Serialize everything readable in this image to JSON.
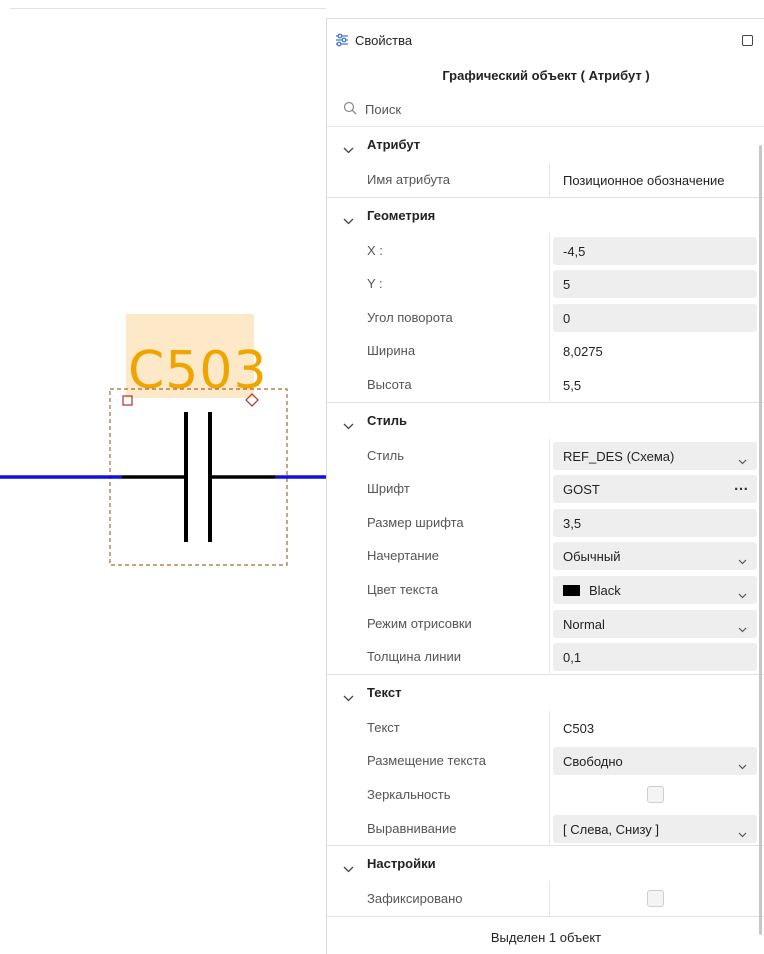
{
  "canvas": {
    "ref_designator": "C503",
    "colors": {
      "wire": "#1010e0",
      "symbol": "#000000",
      "label": "#f0a400",
      "label_bg": "#fde9c8",
      "selection": "#a06a3a"
    }
  },
  "panel": {
    "title": "Свойства",
    "object_title": "Графический объект ( Атрибут )",
    "search_placeholder": "Поиск",
    "status": "Выделен 1 объект",
    "icons": {
      "panel": "settings-sliders-icon",
      "maximize": "maximize-icon",
      "search": "search-icon"
    }
  },
  "sections": [
    {
      "title": "Атрибут",
      "rows": [
        {
          "label": "Имя атрибута",
          "value": "Позиционное обозначение",
          "control": "text"
        }
      ]
    },
    {
      "title": "Геометрия",
      "rows": [
        {
          "label": "X :",
          "value": "-4,5",
          "control": "input"
        },
        {
          "label": "Y :",
          "value": "5",
          "control": "input"
        },
        {
          "label": "Угол поворота",
          "value": "0",
          "control": "input"
        },
        {
          "label": "Ширина",
          "value": "8,0275",
          "control": "text"
        },
        {
          "label": "Высота",
          "value": "5,5",
          "control": "text"
        }
      ]
    },
    {
      "title": "Стиль",
      "rows": [
        {
          "label": "Стиль",
          "value": "REF_DES (Схема)",
          "control": "select"
        },
        {
          "label": "Шрифт",
          "value": "GOST",
          "control": "more"
        },
        {
          "label": "Размер шрифта",
          "value": "3,5",
          "control": "input"
        },
        {
          "label": "Начертание",
          "value": "Обычный",
          "control": "select"
        },
        {
          "label": "Цвет текста",
          "value": "Black",
          "control": "color-select",
          "swatch": "#000000"
        },
        {
          "label": "Режим отрисовки",
          "value": "Normal",
          "control": "select"
        },
        {
          "label": "Толщина линии",
          "value": "0,1",
          "control": "input"
        }
      ]
    },
    {
      "title": "Текст",
      "rows": [
        {
          "label": "Текст",
          "value": "C503",
          "control": "text"
        },
        {
          "label": "Размещение текста",
          "value": "Свободно",
          "control": "select"
        },
        {
          "label": "Зеркальность",
          "value": "",
          "control": "checkbox",
          "checked": false
        },
        {
          "label": "Выравнивание",
          "value": "[ Слева, Снизу ]",
          "control": "select"
        }
      ]
    },
    {
      "title": "Настройки",
      "rows": [
        {
          "label": "Зафиксировано",
          "value": "",
          "control": "checkbox",
          "checked": false
        }
      ]
    }
  ]
}
